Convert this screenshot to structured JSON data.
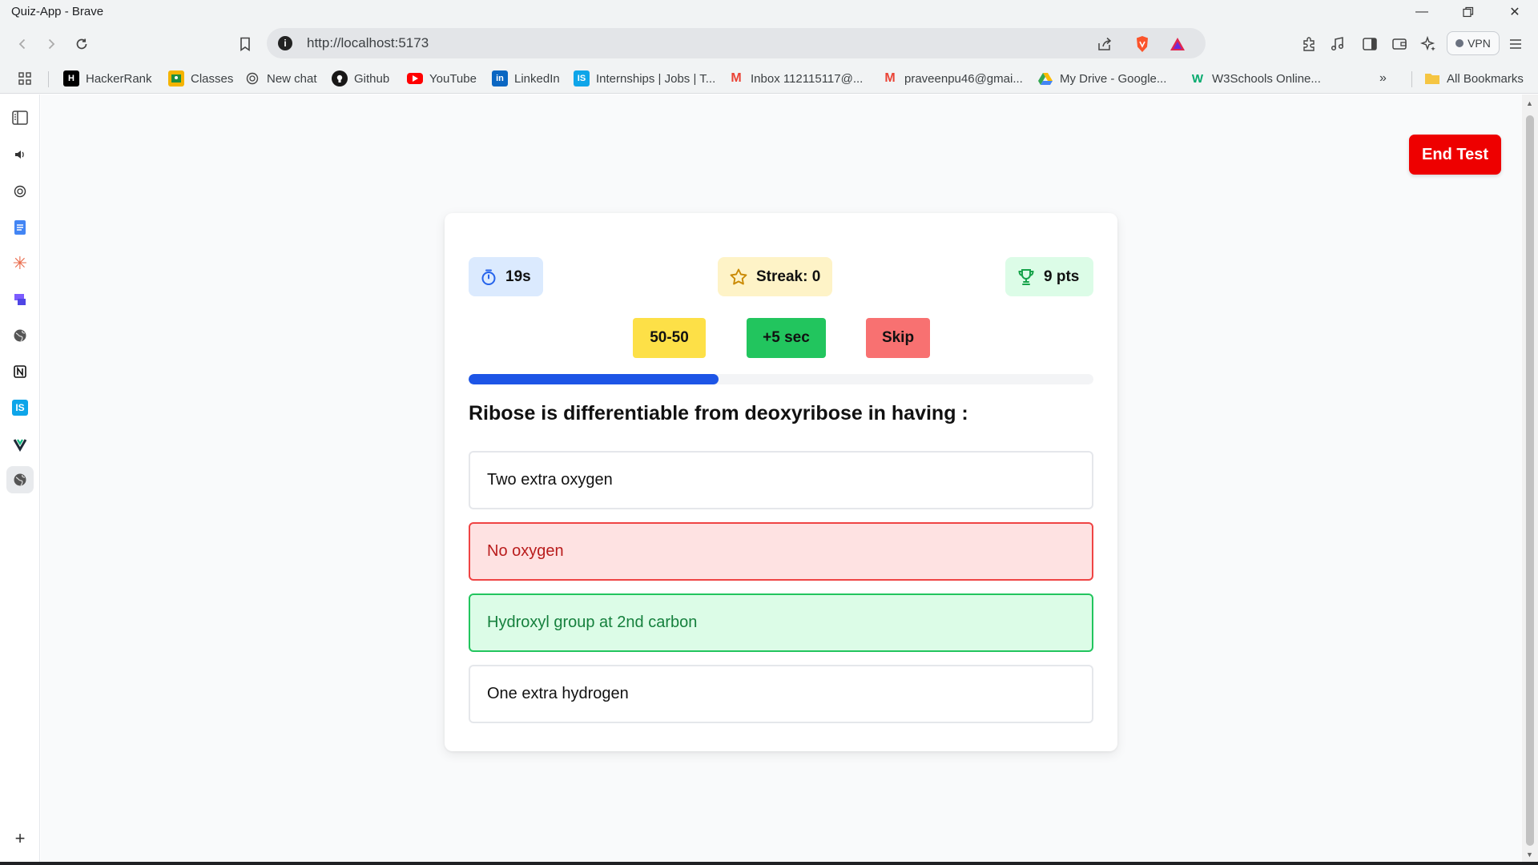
{
  "window": {
    "title": "Quiz-App - Brave"
  },
  "navbar": {
    "url": "http://localhost:5173",
    "vpn_label": "VPN"
  },
  "bookmarks": [
    {
      "label": "HackerRank",
      "icon": "hackerrank-icon",
      "color": "#000000",
      "glyph": "H"
    },
    {
      "label": "Classes",
      "icon": "classroom-icon",
      "color": "#f5b400",
      "glyph": ""
    },
    {
      "label": "New chat",
      "icon": "openai-icon",
      "color": "#444444",
      "glyph": ""
    },
    {
      "label": "Github",
      "icon": "github-icon",
      "color": "#181717",
      "glyph": ""
    },
    {
      "label": "YouTube",
      "icon": "youtube-icon",
      "color": "#ff0000",
      "glyph": ""
    },
    {
      "label": "LinkedIn",
      "icon": "linkedin-icon",
      "color": "#0a66c2",
      "glyph": "in"
    },
    {
      "label": "Internships | Jobs | T...",
      "icon": "internshala-icon",
      "color": "#0ea5e9",
      "glyph": "IS"
    },
    {
      "label": "Inbox 112115117@...",
      "icon": "gmail-icon",
      "color": "#ea4335",
      "glyph": "M"
    },
    {
      "label": "praveenpu46@gmai...",
      "icon": "gmail-icon",
      "color": "#ea4335",
      "glyph": "M"
    },
    {
      "label": "My Drive - Google...",
      "icon": "google-drive-icon",
      "color": "#34a853",
      "glyph": ""
    },
    {
      "label": "W3Schools Online...",
      "icon": "w3schools-icon",
      "color": "#04aa6d",
      "glyph": "W"
    }
  ],
  "all_bookmarks_label": "All Bookmarks",
  "quiz": {
    "end_test_label": "End Test",
    "timer": "19s",
    "streak": "Streak: 0",
    "points": "9 pts",
    "lifelines": {
      "fifty": "50-50",
      "plus": "+5 sec",
      "skip": "Skip"
    },
    "progress_fraction": 0.4,
    "question": "Ribose is differentiable from deoxyribose in having :",
    "options": [
      {
        "text": "Two extra oxygen",
        "state": "neutral"
      },
      {
        "text": "No oxygen",
        "state": "wrong"
      },
      {
        "text": "Hydroxyl group at 2nd carbon",
        "state": "correct"
      },
      {
        "text": "One extra hydrogen",
        "state": "neutral"
      }
    ]
  },
  "colors": {
    "end_test": "#ee0000",
    "progress": "#1d55e6",
    "wrong_border": "#ef4444",
    "correct_border": "#22c55e"
  }
}
